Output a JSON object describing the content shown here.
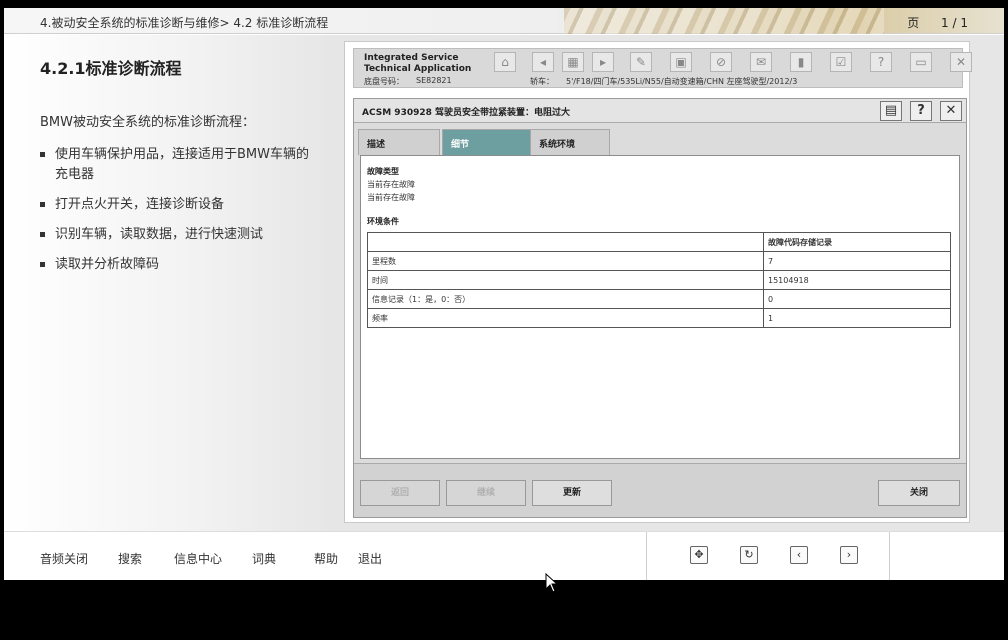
{
  "header": {
    "breadcrumb": "4.被动安全系统的标准诊断与维修> 4.2 标准诊断流程",
    "page_label": "页",
    "page_value": "1 / 1"
  },
  "left": {
    "title": "4.2.1标准诊断流程",
    "intro": "BMW被动安全系统的标准诊断流程：",
    "items": [
      "使用车辆保护用品，连接适用于BMW车辆的充电器",
      "打开点火开关，连接诊断设备",
      "识别车辆，读取数据，进行快速测试",
      "读取并分析故障码"
    ]
  },
  "ista": {
    "brand_line1": "Integrated Service",
    "brand_line2": "Technical Application",
    "chassis_label": "底盘号码：",
    "chassis_value": "SE82821",
    "vehicle_label": "轿车：",
    "vehicle_value": "5'/F18/四门车/535Li/N55/自动变速箱/CHN 左座驾驶型/2012/3",
    "toolbar_icons": [
      "home-icon",
      "back-icon",
      "diagram-icon",
      "forward-icon",
      "wrench-icon",
      "monitor-icon",
      "link-icon",
      "mail-icon",
      "battery-icon",
      "check-icon",
      "help-icon",
      "minimize-icon",
      "close-icon"
    ],
    "dialog": {
      "title": "ACSM 930928  驾驶员安全带拉紧装置：电阻过大",
      "tabs": [
        "描述",
        "细节",
        "系统环境"
      ],
      "active_tab": "细节",
      "fault_type_heading": "故障类型",
      "fault_lines": [
        "当前存在故障",
        "当前存在故障"
      ],
      "env_heading": "环境条件",
      "table_header": [
        "",
        "故障代码存储记录"
      ],
      "table_rows": [
        [
          "里程数",
          "7"
        ],
        [
          "时间",
          "15104918"
        ],
        [
          "信息记录（1：是，0：否）",
          "0"
        ],
        [
          "频率",
          "1"
        ]
      ],
      "buttons": {
        "back": "返回",
        "continue": "继续",
        "update": "更新",
        "close": "关闭"
      }
    }
  },
  "bottom": {
    "nav": [
      "音频关闭",
      "搜索",
      "信息中心",
      "词典",
      "帮助",
      "退出"
    ],
    "controls": [
      "fit-icon",
      "refresh-icon",
      "prev-icon",
      "next-icon"
    ]
  }
}
